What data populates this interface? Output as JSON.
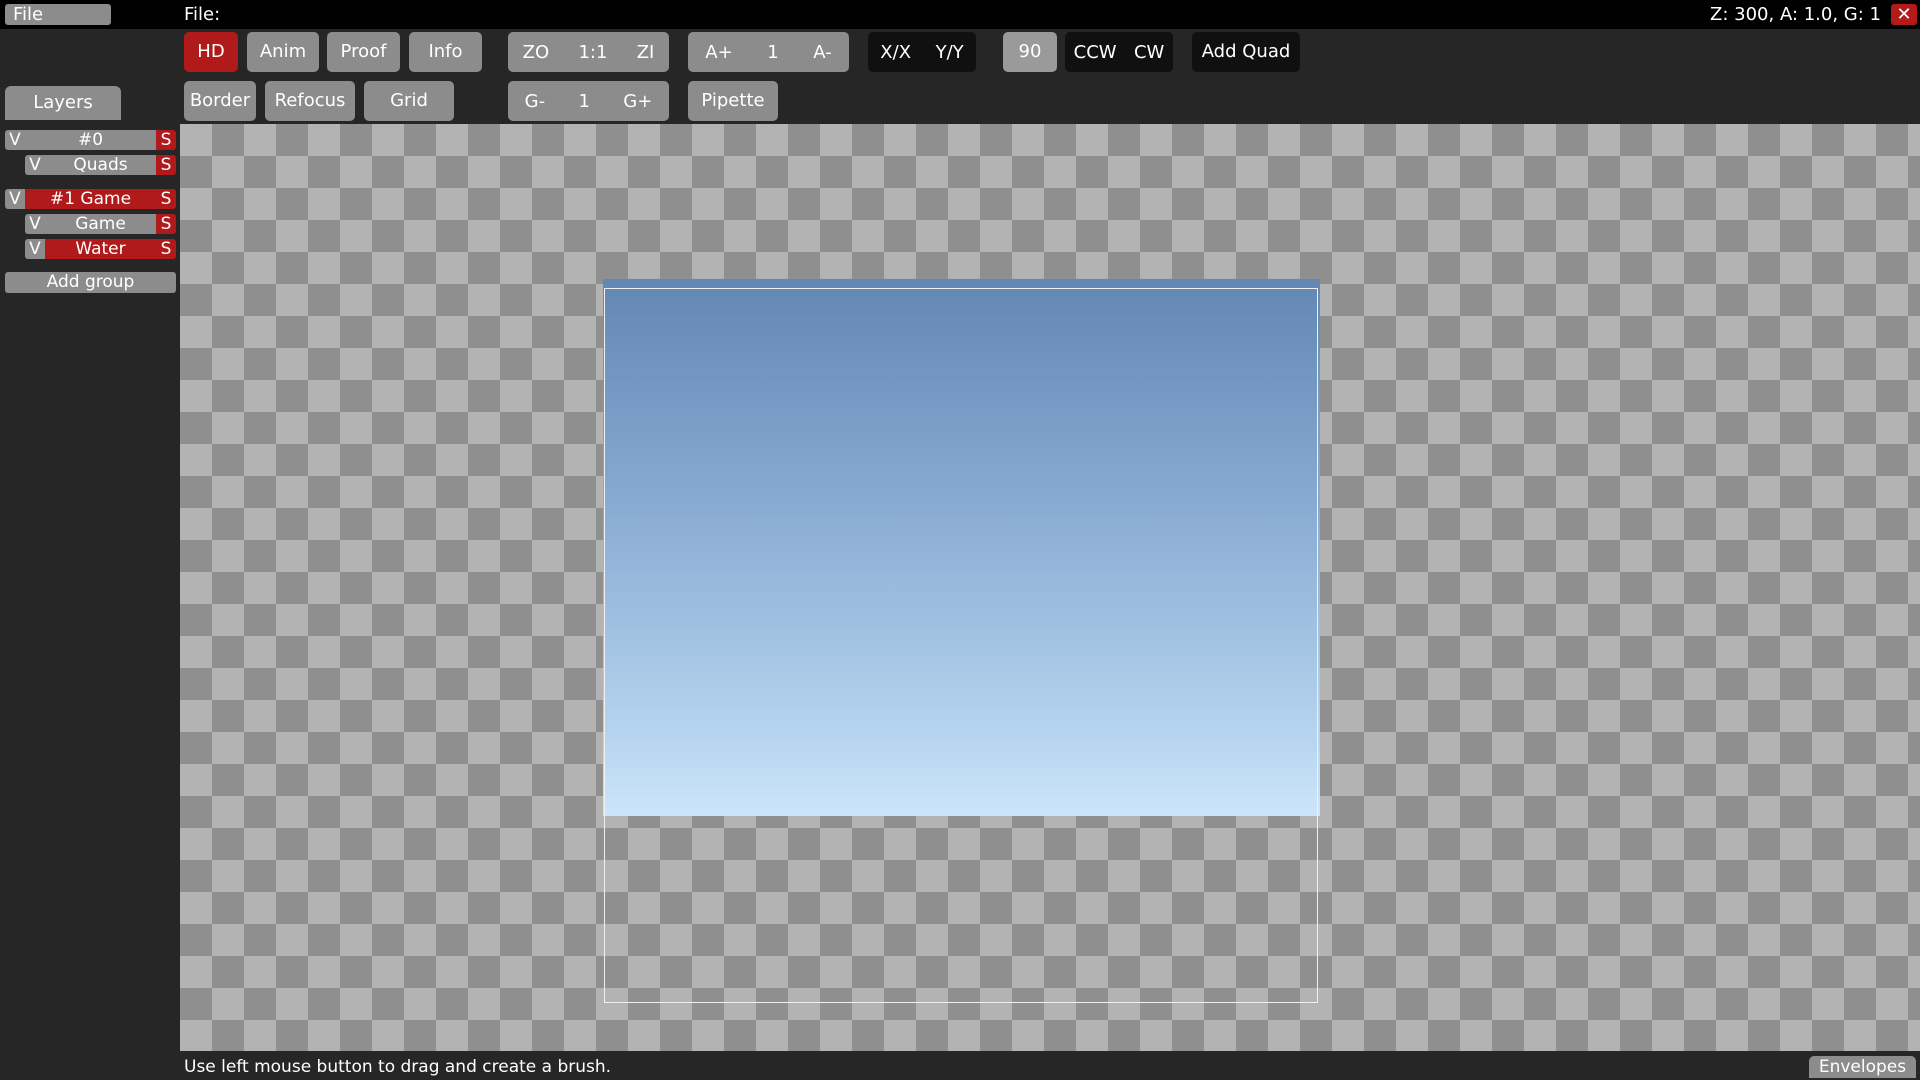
{
  "menubar": {
    "file_menu": "File",
    "file_label": "File:",
    "status": "Z: 300, A: 1.0, G: 1",
    "close": "✕"
  },
  "toolbar": {
    "hd": "HD",
    "anim": "Anim",
    "proof": "Proof",
    "info": "Info",
    "zoom_out": "ZO",
    "zoom_reset": "1:1",
    "zoom_in": "ZI",
    "anim_faster": "A+",
    "anim_value": "1",
    "anim_slower": "A-",
    "flip_x": "X/X",
    "flip_y": "Y/Y",
    "rotation": "90",
    "ccw": "CCW",
    "cw": "CW",
    "add_quad": "Add Quad",
    "border": "Border",
    "refocus": "Refocus",
    "grid": "Grid",
    "grid_smaller": "G-",
    "grid_value": "1",
    "grid_larger": "G+",
    "pipette": "Pipette"
  },
  "sidebar": {
    "tab": "Layers",
    "groups": [
      {
        "name": "#0",
        "visible": "V",
        "solo": "S",
        "layers": [
          {
            "name": "Quads",
            "visible": "V",
            "solo": "S"
          }
        ]
      },
      {
        "name": "#1 Game",
        "visible": "V",
        "solo": "S",
        "layers": [
          {
            "name": "Game",
            "visible": "V",
            "solo": "S"
          },
          {
            "name": "Water",
            "visible": "V",
            "solo": "S"
          }
        ]
      }
    ],
    "add_group": "Add group"
  },
  "statusbar": {
    "hint": "Use left mouse button to drag and create a brush.",
    "envelopes": "Envelopes"
  },
  "colors": {
    "accent_red": "#b01a1a",
    "button_gray": "#8c8c8c",
    "sky_top": "#6287b2",
    "sky_bottom": "#cde5fb"
  }
}
